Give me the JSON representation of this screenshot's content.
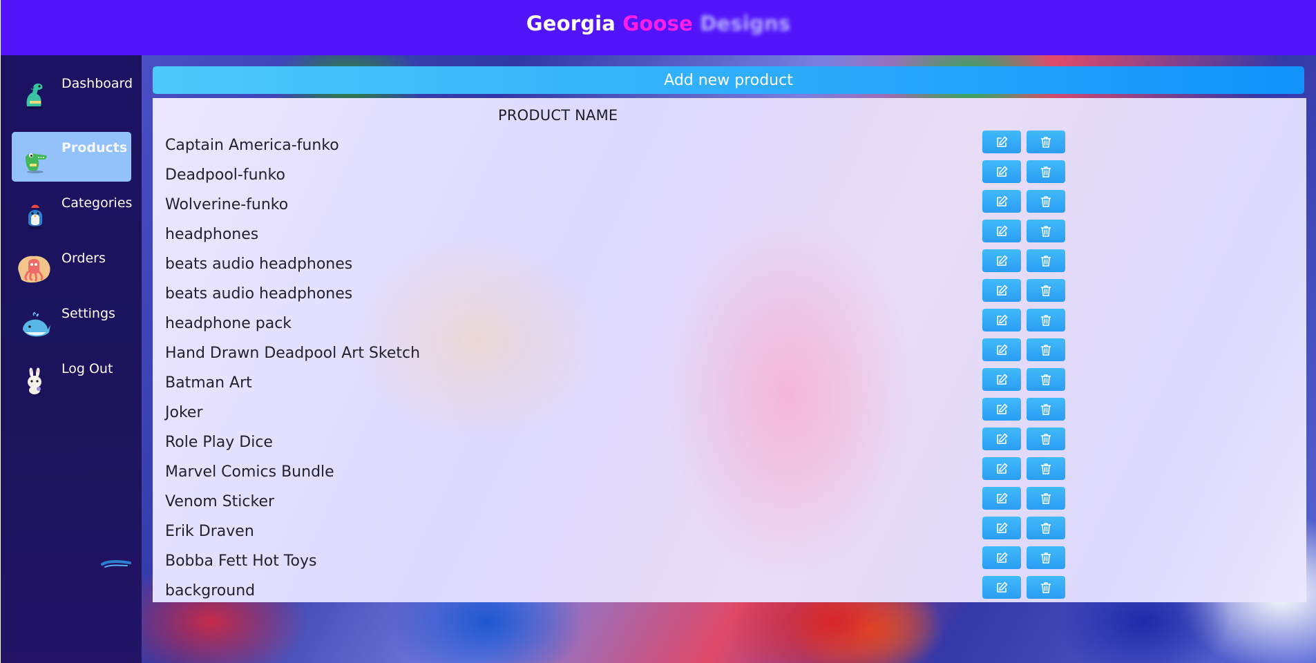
{
  "header": {
    "brand_part1": "Georgia",
    "brand_part2": "Goose",
    "brand_part3": "Designs"
  },
  "sidebar": {
    "items": [
      {
        "label": "Dashboard",
        "icon": "dinosaur-icon",
        "active": false
      },
      {
        "label": "Products",
        "icon": "crocodile-icon",
        "active": true
      },
      {
        "label": "Categories",
        "icon": "penguin-icon",
        "active": false
      },
      {
        "label": "Orders",
        "icon": "octopus-icon",
        "active": false
      },
      {
        "label": "Settings",
        "icon": "whale-icon",
        "active": false
      },
      {
        "label": "Log Out",
        "icon": "rabbit-icon",
        "active": false
      }
    ]
  },
  "main": {
    "add_button_label": "Add new product",
    "table": {
      "column_header": "PRODUCT NAME",
      "rows": [
        "Captain America-funko",
        "Deadpool-funko",
        "Wolverine-funko",
        "headphones",
        "beats audio headphones",
        "beats audio headphones",
        "headphone pack",
        "Hand Drawn Deadpool Art Sketch",
        "Batman Art",
        "Joker",
        "Role Play Dice",
        "Marvel Comics Bundle",
        "Venom Sticker",
        "Erik Draven",
        "Bobba Fett Hot Toys",
        "background"
      ],
      "row_actions": [
        "edit-icon",
        "trash-icon"
      ]
    }
  },
  "colors": {
    "header_bg": "#5215fa",
    "brand_accent": "#ff1ee6",
    "sidebar_bg": "#1c1262",
    "active_item_bg": "#93c2fb",
    "button_blue": "#2aa9fb"
  }
}
